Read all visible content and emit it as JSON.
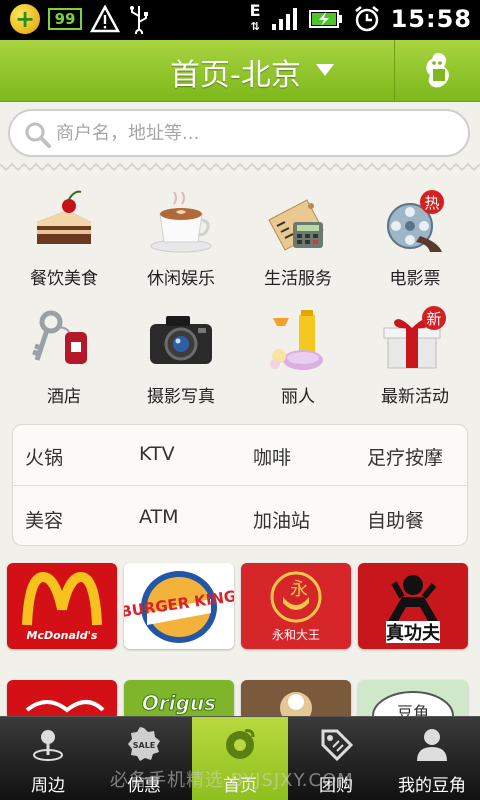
{
  "statusbar": {
    "battery_level": "99",
    "network": "E",
    "time": "15:58"
  },
  "header": {
    "title": "首页-北京"
  },
  "search": {
    "placeholder": "商户名，地址等..."
  },
  "categories": [
    {
      "label": "餐饮美食",
      "icon": "cake-icon"
    },
    {
      "label": "休闲娱乐",
      "icon": "coffee-icon"
    },
    {
      "label": "生活服务",
      "icon": "calculator-icon"
    },
    {
      "label": "电影票",
      "icon": "film-reel-icon",
      "badge": "热"
    },
    {
      "label": "酒店",
      "icon": "key-icon"
    },
    {
      "label": "摄影写真",
      "icon": "camera-icon"
    },
    {
      "label": "丽人",
      "icon": "cosmetics-icon"
    },
    {
      "label": "最新活动",
      "icon": "gift-icon",
      "badge": "新"
    }
  ],
  "quick_tags": [
    "火锅",
    "KTV",
    "咖啡",
    "足疗按摩",
    "美容",
    "ATM",
    "加油站",
    "自助餐"
  ],
  "brands": [
    {
      "name": "McDonald's",
      "logo": "mcdonalds-logo"
    },
    {
      "name": "BURGER KING",
      "logo": "burger-king-logo"
    },
    {
      "name": "永和大王",
      "logo": "yonghe-logo"
    },
    {
      "name": "真功夫",
      "logo": "zhengongfu-logo"
    }
  ],
  "brands_row2": [
    {
      "logo": "brand-partial-1"
    },
    {
      "name": "Origus",
      "logo": "origus-logo"
    },
    {
      "logo": "brand-partial-3"
    },
    {
      "name": "豆角",
      "logo": "brand-partial-4"
    }
  ],
  "bottom_nav": [
    {
      "label": "周边",
      "icon": "location-pin-icon"
    },
    {
      "label": "优惠",
      "icon": "sale-tag-icon"
    },
    {
      "label": "首页",
      "icon": "home-bean-icon",
      "active": true
    },
    {
      "label": "团购",
      "icon": "price-tag-icon"
    },
    {
      "label": "我的豆角",
      "icon": "user-icon"
    }
  ],
  "watermark": "必备手机精选 BYJSJXY.COM",
  "colors": {
    "accent_green": "#8ebf1f",
    "header_green": "#7db81c",
    "badge_red": "#d42020"
  }
}
